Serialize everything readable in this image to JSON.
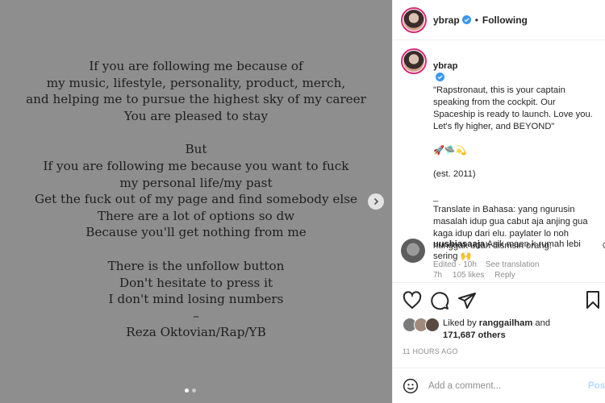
{
  "poem": {
    "stanza1": [
      "If you are following me because of",
      "my music, lifestyle, personality, product, merch,",
      "and helping me to pursue the highest sky of my career",
      "You are pleased to stay"
    ],
    "stanza2": [
      "But",
      "If you are following me because you want to fuck",
      "my personal life/my past",
      "Get the fuck out of my page and find somebody else",
      "There are a lot of options so dw",
      "Because you'll get nothing from me"
    ],
    "stanza3": [
      "There is the unfollow button",
      "Don't hesitate to press it",
      "I don't mind losing numbers",
      "–",
      "Reza Oktovian/Rap/YB"
    ]
  },
  "header": {
    "username": "ybrap",
    "bullet": "•",
    "follow_status": "Following"
  },
  "caption": {
    "username": "ybrap",
    "text": "\"Rapstronaut, this is your captain speaking from the cockpit. Our Spaceship is ready to launch. Love you. Let's fly higher, and BEYOND\"",
    "emojis": "🚀🛸💫",
    "est": "(est. 2011)",
    "dash": "_",
    "translate": "Translate in Bahasa: yang ngurusin masalah idup gua cabut aja anjing gua kaga idup dari elu. paylater lo noh nunggak udah dismsin orang.",
    "edited": "Edited · 10h",
    "see_translation": "See translation"
  },
  "comment": {
    "username": "uusbiasaaja",
    "text": "Asik maen k rumah lebi sering 🙌",
    "time": "7h",
    "likes": "105 likes",
    "reply": "Reply"
  },
  "likes": {
    "prefix": "Liked by",
    "user": "ranggailham",
    "and": "and",
    "count": "171,687 others"
  },
  "timestamp": "11 HOURS AGO",
  "add_comment": {
    "placeholder": "Add a comment...",
    "post_label": "Post"
  },
  "icons": [
    "verified-icon",
    "chevron-right-icon",
    "heart-icon",
    "comment-icon",
    "share-icon",
    "bookmark-icon",
    "emoji-icon"
  ],
  "colors": {
    "verified": "#3897f0",
    "story_ring": "#d62976",
    "post_button": "#b3dbff",
    "meta_text": "#8e8e8e"
  }
}
